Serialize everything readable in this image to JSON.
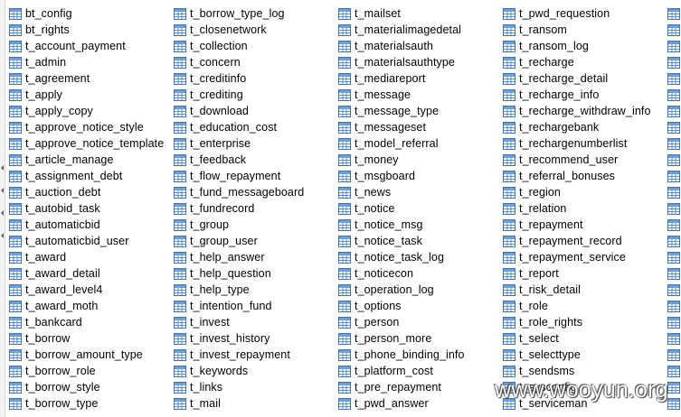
{
  "columns": [
    [
      "bt_config",
      "bt_rights",
      "t_account_payment",
      "t_admin",
      "t_agreement",
      "t_apply",
      "t_apply_copy",
      "t_approve_notice_style",
      "t_approve_notice_template",
      "t_article_manage",
      "t_assignment_debt",
      "t_auction_debt",
      "t_autobid_task",
      "t_automaticbid",
      "t_automaticbid_user",
      "t_award",
      "t_award_detail",
      "t_award_level4",
      "t_award_moth",
      "t_bankcard",
      "t_borrow",
      "t_borrow_amount_type",
      "t_borrow_role",
      "t_borrow_style",
      "t_borrow_type"
    ],
    [
      "t_borrow_type_log",
      "t_closenetwork",
      "t_collection",
      "t_concern",
      "t_creditinfo",
      "t_crediting",
      "t_download",
      "t_education_cost",
      "t_enterprise",
      "t_feedback",
      "t_flow_repayment",
      "t_fund_messageboard",
      "t_fundrecord",
      "t_group",
      "t_group_user",
      "t_help_answer",
      "t_help_question",
      "t_help_type",
      "t_intention_fund",
      "t_invest",
      "t_invest_history",
      "t_invest_repayment",
      "t_keywords",
      "t_links",
      "t_mail"
    ],
    [
      "t_mailset",
      "t_materialimagedetal",
      "t_materialsauth",
      "t_materialsauthtype",
      "t_mediareport",
      "t_message",
      "t_message_type",
      "t_messageset",
      "t_model_referral",
      "t_money",
      "t_msgboard",
      "t_news",
      "t_notice",
      "t_notice_msg",
      "t_notice_task",
      "t_notice_task_log",
      "t_noticecon",
      "t_operation_log",
      "t_options",
      "t_person",
      "t_person_more",
      "t_phone_binding_info",
      "t_platform_cost",
      "t_pre_repayment",
      "t_pwd_answer"
    ],
    [
      "t_pwd_requestion",
      "t_ransom",
      "t_ransom_log",
      "t_recharge",
      "t_recharge_detail",
      "t_recharge_info",
      "t_recharge_withdraw_info",
      "t_rechargebank",
      "t_rechargenumberlist",
      "t_recommend_user",
      "t_referral_bonuses",
      "t_region",
      "t_relation",
      "t_repayment",
      "t_repayment_record",
      "t_repayment_service",
      "t_report",
      "t_risk_detail",
      "t_role",
      "t_role_rights",
      "t_select",
      "t_selecttype",
      "t_sendsms",
      "t_sysconfig",
      "t_serviceman"
    ]
  ],
  "partial_column_count": 25,
  "icon": "table-icon",
  "watermark": "www.wooyun.org",
  "colors": {
    "icon_border": "#3a73b8",
    "icon_header": "#6d9fd8",
    "icon_cell": "#ffffff",
    "watermark_stroke": "#333333"
  }
}
